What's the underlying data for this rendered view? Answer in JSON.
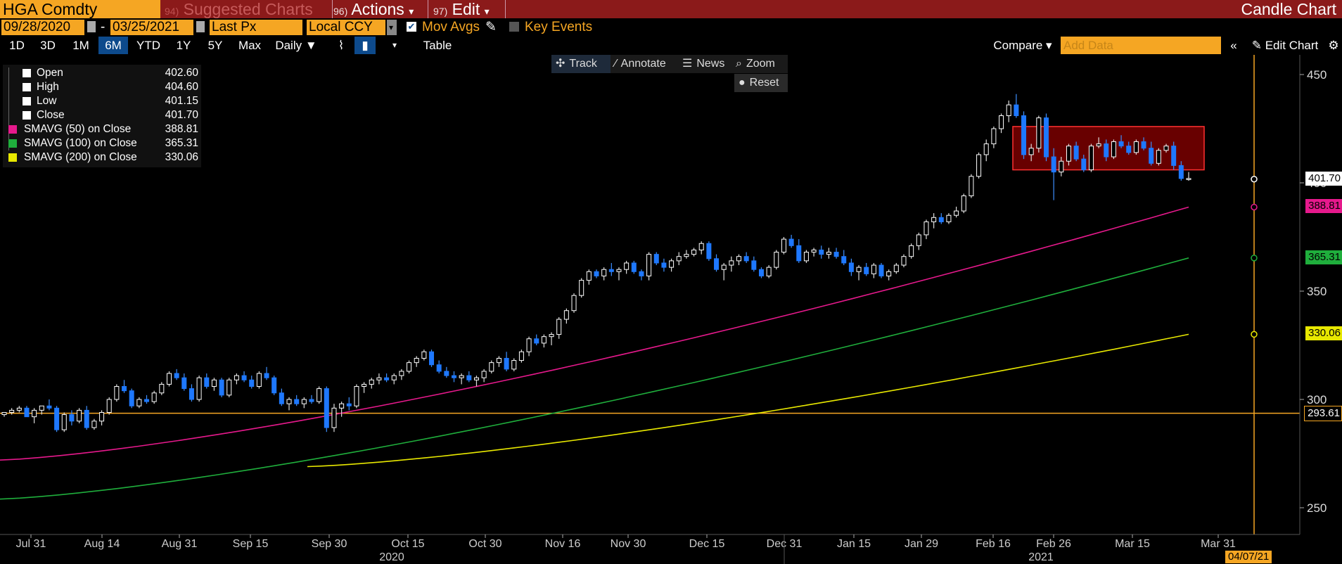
{
  "header": {
    "ticker": "HGA Comdty",
    "menus": [
      {
        "num": "94)",
        "label": "Suggested Charts"
      },
      {
        "num": "96)",
        "label": "Actions",
        "arrow": "▾"
      },
      {
        "num": "97)",
        "label": "Edit",
        "arrow": "▾"
      }
    ],
    "chart_type": "Candle Chart"
  },
  "settings": {
    "start_date": "09/28/2020",
    "dash": "-",
    "end_date": "03/25/2021",
    "price_field": "Last Px",
    "currency": "Local CCY",
    "mov_avgs": "Mov Avgs",
    "key_events": "Key Events"
  },
  "periods": [
    "1D",
    "3D",
    "1M",
    "6M",
    "YTD",
    "1Y",
    "5Y",
    "Max"
  ],
  "active_period": "6M",
  "frequency": "Daily ▼",
  "table_label": "Table",
  "compare_label": "Compare ▾",
  "add_data_placeholder": "Add Data",
  "edit_chart_label": "Edit Chart",
  "chart_tools": {
    "track": "Track",
    "annotate": "Annotate",
    "news": "News",
    "zoom": "Zoom",
    "reset": "Reset"
  },
  "legend": [
    {
      "name": "Open",
      "value": "402.60",
      "color": "#ffffff"
    },
    {
      "name": "High",
      "value": "404.60",
      "color": "#ffffff"
    },
    {
      "name": "Low",
      "value": "401.15",
      "color": "#ffffff"
    },
    {
      "name": "Close",
      "value": "401.70",
      "color": "#ffffff"
    },
    {
      "name": "SMAVG (50)  on Close",
      "value": "388.81",
      "color": "#e6198c"
    },
    {
      "name": "SMAVG (100)  on Close",
      "value": "365.31",
      "color": "#1fae3c"
    },
    {
      "name": "SMAVG (200)  on Close",
      "value": "330.06",
      "color": "#e8e800"
    }
  ],
  "right_labels": [
    {
      "value": "401.70",
      "color": "#ffffff",
      "text_color": "#000000"
    },
    {
      "value": "388.81",
      "color": "#e6198c",
      "text_color": "#000000"
    },
    {
      "value": "365.31",
      "color": "#1fae3c",
      "text_color": "#000000"
    },
    {
      "value": "330.06",
      "color": "#e8e800",
      "text_color": "#000000"
    },
    {
      "value": "293.61",
      "color": "#000000",
      "text_color": "#ffffff"
    }
  ],
  "date_box": "04/07/21",
  "chart_data": {
    "type": "candlestick",
    "ylim": [
      220,
      465
    ],
    "yticks": [
      250,
      300,
      350,
      400,
      450
    ],
    "xticks": [
      "Jul 31",
      "Aug 14",
      "Aug 31",
      "Sep 15",
      "Sep 30",
      "Oct 15",
      "Oct 30",
      "Nov 16",
      "Nov 30",
      "Dec 15",
      "Dec 31",
      "Jan 15",
      "Jan 29",
      "Feb 16",
      "Feb 26",
      "Mar 15",
      "Mar 31"
    ],
    "years": [
      "2020",
      "2021"
    ],
    "horizontal_line": 293.61,
    "highlight_range": [
      406,
      426
    ],
    "candles": [
      [
        293,
        294,
        292,
        294
      ],
      [
        294,
        296,
        293,
        295
      ],
      [
        295,
        297,
        294,
        296
      ],
      [
        296,
        297,
        292,
        292
      ],
      [
        292,
        296,
        289,
        295
      ],
      [
        295,
        297,
        293,
        297
      ],
      [
        297,
        300,
        295,
        296
      ],
      [
        296,
        297,
        285,
        286
      ],
      [
        286,
        294,
        285,
        293
      ],
      [
        293,
        295,
        288,
        290
      ],
      [
        290,
        296,
        289,
        295
      ],
      [
        295,
        297,
        286,
        287
      ],
      [
        287,
        291,
        286,
        290
      ],
      [
        290,
        295,
        288,
        294
      ],
      [
        294,
        301,
        293,
        300
      ],
      [
        300,
        307,
        299,
        306
      ],
      [
        306,
        309,
        303,
        304
      ],
      [
        304,
        305,
        296,
        297
      ],
      [
        297,
        301,
        296,
        300
      ],
      [
        300,
        302,
        298,
        299
      ],
      [
        299,
        304,
        298,
        303
      ],
      [
        303,
        308,
        302,
        307
      ],
      [
        307,
        313,
        306,
        312
      ],
      [
        312,
        314,
        309,
        310
      ],
      [
        310,
        312,
        304,
        305
      ],
      [
        305,
        307,
        299,
        300
      ],
      [
        300,
        311,
        299,
        310
      ],
      [
        310,
        312,
        305,
        306
      ],
      [
        306,
        310,
        304,
        309
      ],
      [
        309,
        310,
        301,
        302
      ],
      [
        302,
        310,
        301,
        309
      ],
      [
        309,
        312,
        307,
        311
      ],
      [
        311,
        313,
        308,
        309
      ],
      [
        309,
        311,
        305,
        306
      ],
      [
        306,
        313,
        305,
        312
      ],
      [
        312,
        315,
        309,
        310
      ],
      [
        310,
        311,
        302,
        303
      ],
      [
        303,
        305,
        297,
        298
      ],
      [
        298,
        301,
        295,
        300
      ],
      [
        300,
        302,
        297,
        298
      ],
      [
        298,
        301,
        296,
        300
      ],
      [
        300,
        302,
        298,
        299
      ],
      [
        299,
        306,
        298,
        305
      ],
      [
        305,
        306,
        285,
        287
      ],
      [
        287,
        298,
        285,
        296
      ],
      [
        296,
        299,
        292,
        298
      ],
      [
        298,
        301,
        295,
        297
      ],
      [
        297,
        307,
        296,
        306
      ],
      [
        306,
        308,
        303,
        307
      ],
      [
        307,
        310,
        305,
        309
      ],
      [
        309,
        312,
        307,
        310
      ],
      [
        310,
        312,
        308,
        309
      ],
      [
        309,
        312,
        307,
        311
      ],
      [
        311,
        314,
        309,
        313
      ],
      [
        313,
        318,
        312,
        317
      ],
      [
        317,
        320,
        315,
        319
      ],
      [
        319,
        323,
        318,
        322
      ],
      [
        322,
        323,
        315,
        316
      ],
      [
        316,
        318,
        312,
        313
      ],
      [
        313,
        315,
        310,
        311
      ],
      [
        311,
        313,
        308,
        310
      ],
      [
        310,
        312,
        307,
        311
      ],
      [
        311,
        313,
        308,
        309
      ],
      [
        309,
        311,
        306,
        310
      ],
      [
        310,
        314,
        308,
        313
      ],
      [
        313,
        318,
        312,
        317
      ],
      [
        317,
        320,
        315,
        319
      ],
      [
        319,
        322,
        313,
        314
      ],
      [
        314,
        319,
        313,
        318
      ],
      [
        318,
        323,
        317,
        322
      ],
      [
        322,
        329,
        320,
        328
      ],
      [
        328,
        330,
        325,
        326
      ],
      [
        326,
        330,
        324,
        329
      ],
      [
        329,
        331,
        325,
        330
      ],
      [
        330,
        338,
        328,
        337
      ],
      [
        337,
        342,
        335,
        341
      ],
      [
        341,
        349,
        340,
        348
      ],
      [
        348,
        356,
        347,
        355
      ],
      [
        355,
        360,
        353,
        359
      ],
      [
        359,
        360,
        356,
        357
      ],
      [
        357,
        361,
        355,
        360
      ],
      [
        360,
        363,
        357,
        359
      ],
      [
        359,
        361,
        355,
        360
      ],
      [
        360,
        364,
        358,
        363
      ],
      [
        363,
        364,
        358,
        359
      ],
      [
        359,
        360,
        355,
        357
      ],
      [
        357,
        368,
        355,
        367
      ],
      [
        367,
        368,
        362,
        363
      ],
      [
        363,
        365,
        359,
        361
      ],
      [
        361,
        365,
        359,
        364
      ],
      [
        364,
        368,
        362,
        366
      ],
      [
        366,
        369,
        365,
        367
      ],
      [
        367,
        370,
        366,
        369
      ],
      [
        369,
        373,
        367,
        372
      ],
      [
        372,
        373,
        364,
        365
      ],
      [
        365,
        367,
        359,
        360
      ],
      [
        360,
        363,
        355,
        362
      ],
      [
        362,
        366,
        359,
        364
      ],
      [
        364,
        367,
        362,
        366
      ],
      [
        366,
        368,
        363,
        364
      ],
      [
        364,
        366,
        359,
        360
      ],
      [
        360,
        361,
        356,
        357
      ],
      [
        357,
        362,
        356,
        361
      ],
      [
        361,
        369,
        360,
        368
      ],
      [
        368,
        375,
        367,
        374
      ],
      [
        374,
        376,
        370,
        371
      ],
      [
        371,
        374,
        363,
        364
      ],
      [
        364,
        369,
        363,
        368
      ],
      [
        368,
        370,
        366,
        369
      ],
      [
        369,
        371,
        365,
        367
      ],
      [
        367,
        370,
        365,
        368
      ],
      [
        368,
        370,
        365,
        366
      ],
      [
        366,
        369,
        362,
        363
      ],
      [
        363,
        365,
        357,
        359
      ],
      [
        359,
        362,
        355,
        361
      ],
      [
        361,
        363,
        357,
        358
      ],
      [
        358,
        363,
        356,
        362
      ],
      [
        362,
        363,
        356,
        357
      ],
      [
        357,
        360,
        355,
        359
      ],
      [
        359,
        363,
        358,
        362
      ],
      [
        362,
        367,
        361,
        366
      ],
      [
        366,
        372,
        365,
        371
      ],
      [
        371,
        377,
        369,
        376
      ],
      [
        376,
        383,
        374,
        382
      ],
      [
        382,
        386,
        379,
        384
      ],
      [
        384,
        386,
        381,
        382
      ],
      [
        382,
        386,
        381,
        385
      ],
      [
        385,
        389,
        384,
        387
      ],
      [
        387,
        395,
        386,
        394
      ],
      [
        394,
        404,
        393,
        403
      ],
      [
        403,
        414,
        402,
        413
      ],
      [
        413,
        420,
        410,
        418
      ],
      [
        418,
        426,
        416,
        425
      ],
      [
        425,
        432,
        423,
        431
      ],
      [
        431,
        438,
        428,
        436
      ],
      [
        436,
        441,
        430,
        431
      ],
      [
        431,
        433,
        411,
        413
      ],
      [
        413,
        418,
        410,
        416
      ],
      [
        416,
        431,
        414,
        430
      ],
      [
        430,
        432,
        410,
        412
      ],
      [
        412,
        416,
        392,
        405
      ],
      [
        405,
        412,
        403,
        410
      ],
      [
        410,
        418,
        408,
        417
      ],
      [
        417,
        419,
        410,
        411
      ],
      [
        411,
        413,
        405,
        406
      ],
      [
        406,
        418,
        405,
        417
      ],
      [
        417,
        421,
        416,
        418
      ],
      [
        418,
        420,
        410,
        412
      ],
      [
        412,
        420,
        411,
        419
      ],
      [
        419,
        422,
        416,
        417
      ],
      [
        417,
        419,
        413,
        414
      ],
      [
        414,
        420,
        413,
        419
      ],
      [
        419,
        421,
        415,
        416
      ],
      [
        416,
        419,
        408,
        409
      ],
      [
        409,
        416,
        408,
        415
      ],
      [
        415,
        418,
        414,
        417
      ],
      [
        417,
        419,
        406,
        408
      ],
      [
        408,
        410,
        401,
        402
      ],
      [
        402,
        405,
        401,
        402
      ]
    ]
  }
}
